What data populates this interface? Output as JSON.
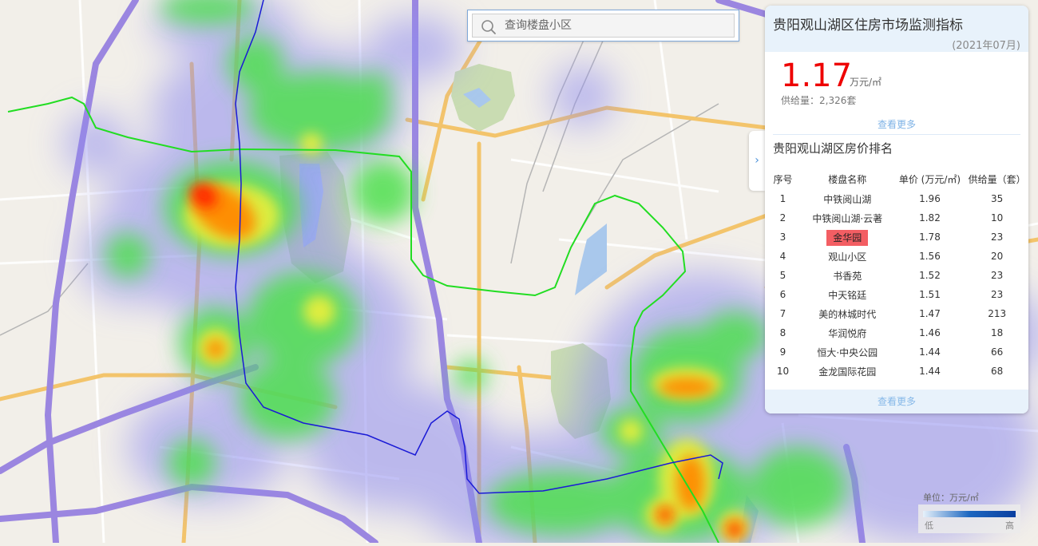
{
  "search": {
    "placeholder": "查询楼盘小区"
  },
  "panel": {
    "title": "贵阳观山湖区住房市场监测指标",
    "date": "(2021年07月)",
    "price_value": "1.17",
    "price_unit": "万元/㎡",
    "supply_label": "供给量：",
    "supply_value": "2,326套",
    "more_link_1": "查看更多",
    "ranking_title": "贵阳观山湖区房价排名",
    "table_headers": [
      "序号",
      "楼盘名称",
      "单价 (万元/㎡)",
      "供给量（套）"
    ],
    "rows": [
      {
        "idx": "1",
        "name": "中铁阅山湖",
        "price": "1.96",
        "supply": "35"
      },
      {
        "idx": "2",
        "name": "中铁阅山湖·云著",
        "price": "1.82",
        "supply": "10"
      },
      {
        "idx": "3",
        "name": "金华园",
        "price": "1.78",
        "supply": "23",
        "highlighted": true
      },
      {
        "idx": "4",
        "name": "观山小区",
        "price": "1.56",
        "supply": "20"
      },
      {
        "idx": "5",
        "name": "书香苑",
        "price": "1.52",
        "supply": "23"
      },
      {
        "idx": "6",
        "name": "中天铭廷",
        "price": "1.51",
        "supply": "23"
      },
      {
        "idx": "7",
        "name": "美的林城时代",
        "price": "1.47",
        "supply": "213"
      },
      {
        "idx": "8",
        "name": "华润悦府",
        "price": "1.46",
        "supply": "18"
      },
      {
        "idx": "9",
        "name": "恒大·中央公园",
        "price": "1.44",
        "supply": "66"
      },
      {
        "idx": "10",
        "name": "金龙国际花园",
        "price": "1.44",
        "supply": "68"
      }
    ],
    "more_link_2": "查看更多",
    "highlight_color": "#f35e63",
    "price_color": "#ee0000"
  },
  "collapse_tab": {
    "icon": "chevron-right-icon",
    "glyph": "›"
  },
  "legend": {
    "unit": "单位：万元/㎡",
    "low": "低",
    "high": "高"
  },
  "map": {
    "icons": [
      "heatmap-layer",
      "road-network",
      "lake",
      "metro-line-blue",
      "metro-line-green"
    ],
    "colors": {
      "metro_blue": "#1a1ad6",
      "metro_green": "#22dd22",
      "expressway": "#9b86e0",
      "arterial": "#f3c46b",
      "water": "#a9c8ec",
      "park": "#c9dcb2"
    }
  }
}
